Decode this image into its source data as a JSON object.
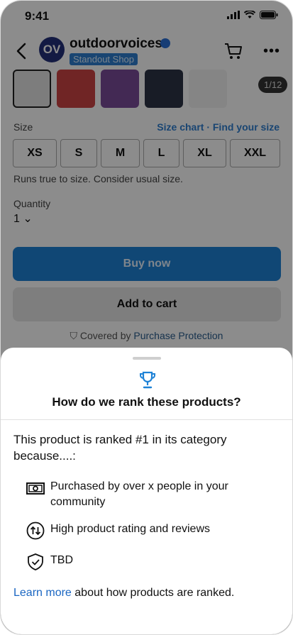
{
  "status_bar": {
    "time": "9:41"
  },
  "header": {
    "avatar_initials": "OV",
    "shop_name": "outdoorvoices",
    "badge": "Standout Shop",
    "pager": "1/12"
  },
  "size": {
    "label": "Size",
    "chart_link": "Size chart · Find your size",
    "options": [
      "XS",
      "S",
      "M",
      "L",
      "XL",
      "XXL"
    ],
    "note": "Runs true to size. Consider usual size."
  },
  "quantity": {
    "label": "Quantity",
    "value": "1"
  },
  "actions": {
    "buy_now": "Buy now",
    "add_to_cart": "Add to cart",
    "protection_prefix": "Covered by",
    "protection_link": "Purchase Protection"
  },
  "sheet": {
    "title": "How do we rank these products?",
    "intro": "This product is ranked #1 in its category because....:",
    "reasons": [
      {
        "icon": "cash-icon",
        "text": "Purchased by over x people in your community"
      },
      {
        "icon": "sort-arrows-icon",
        "text": "High product rating and reviews"
      },
      {
        "icon": "shield-check-icon",
        "text": "TBD"
      }
    ],
    "footer_link": "Learn more",
    "footer_text": " about how products are ranked."
  },
  "colors": {
    "accent": "#1e82d6",
    "link": "#1a66c2",
    "badge_bg": "#2f7ed0",
    "avatar_bg": "#23307a"
  }
}
